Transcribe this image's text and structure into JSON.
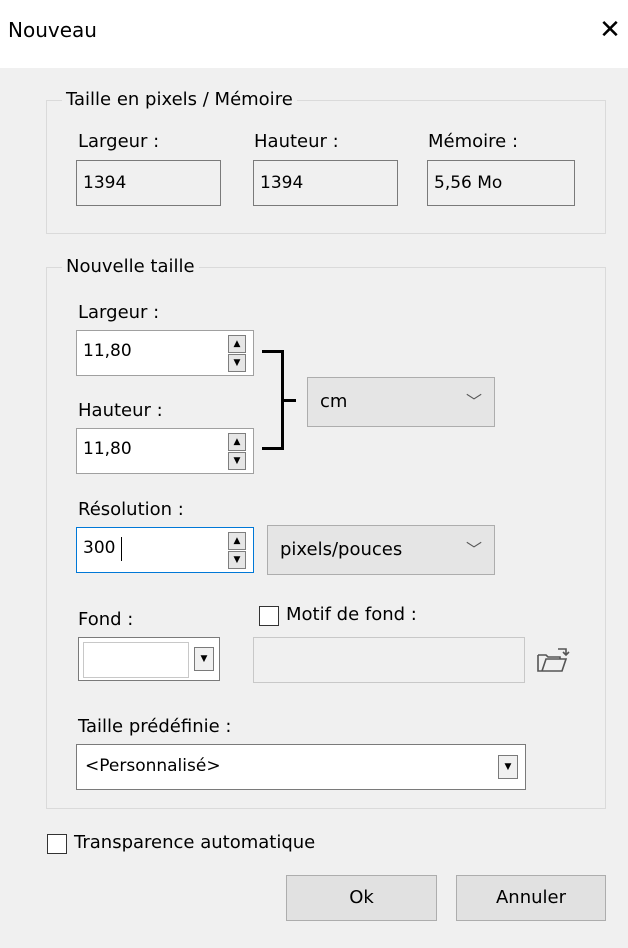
{
  "window": {
    "title": "Nouveau",
    "close_glyph": "✕"
  },
  "memory_group": {
    "legend": "Taille en pixels / Mémoire",
    "width_label": "Largeur :",
    "width_value": "1394",
    "height_label": "Hauteur :",
    "height_value": "1394",
    "memory_label": "Mémoire :",
    "memory_value": "5,56 Mo"
  },
  "new_size_group": {
    "legend": "Nouvelle taille",
    "width_label": "Largeur :",
    "width_value": "11,80",
    "height_label": "Hauteur :",
    "height_value": "11,80",
    "unit_selected": "cm",
    "resolution_label": "Résolution :",
    "resolution_value": "300",
    "resolution_unit_selected": "pixels/pouces",
    "background_label": "Fond :",
    "pattern_checkbox_label": "Motif de fond :",
    "pattern_checked": false,
    "preset_label": "Taille prédéfinie :",
    "preset_selected": "<Personnalisé>"
  },
  "auto_transparency": {
    "label": "Transparence automatique",
    "checked": false
  },
  "buttons": {
    "ok": "Ok",
    "cancel": "Annuler"
  },
  "icons": {
    "close": "close-icon",
    "spin_up": "spin-up-icon",
    "spin_down": "spin-down-icon",
    "chevron": "chevron-down-icon",
    "dropdown": "dropdown-arrow-icon",
    "folder": "folder-open-icon"
  },
  "colors": {
    "focus_border": "#0078d7",
    "titlebar": "#ffffff",
    "background": "#f0f0f0"
  }
}
